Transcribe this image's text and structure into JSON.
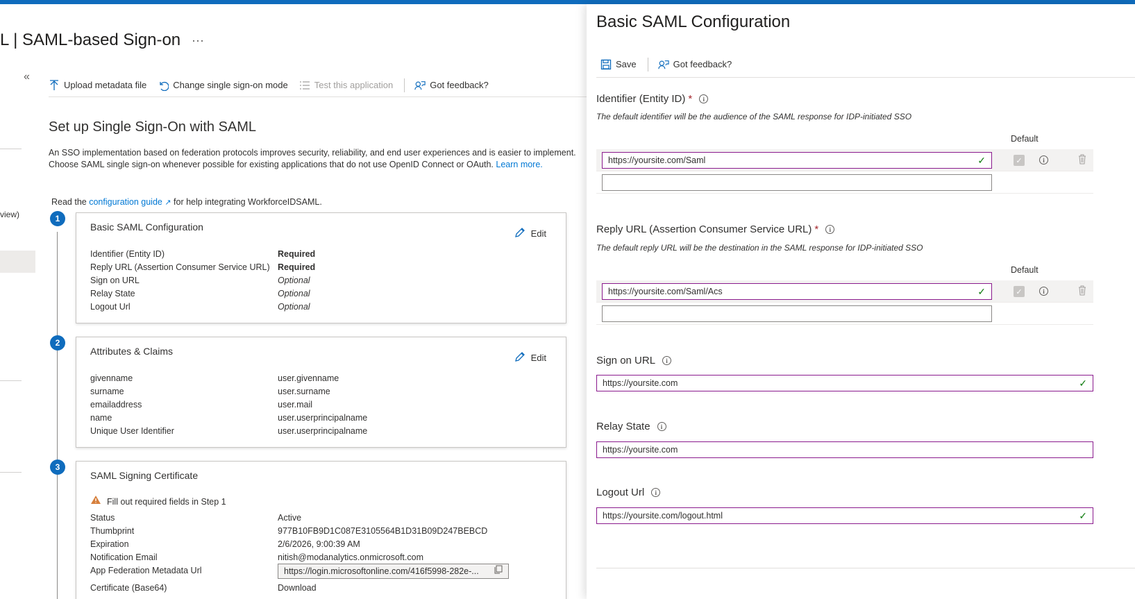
{
  "page": {
    "title": "L | SAML-based Sign-on",
    "more": "···",
    "collapse": "«",
    "nav_partial_text": "view)"
  },
  "toolbar": {
    "upload": "Upload metadata file",
    "change_mode": "Change single sign-on mode",
    "test": "Test this application",
    "feedback": "Got feedback?"
  },
  "setup": {
    "heading": "Set up Single Sign-On with SAML",
    "intro": "An SSO implementation based on federation protocols improves security, reliability, and end user experiences and is easier to implement. Choose SAML single sign-on whenever possible for existing applications that do not use OpenID Connect or OAuth.",
    "learn_more": "Learn more.",
    "read_prefix": "Read the",
    "config_guide": "configuration guide",
    "read_suffix": "for help integrating WorkforceIDSAML."
  },
  "steps": [
    {
      "number": "1",
      "title": "Basic SAML Configuration",
      "edit": "Edit",
      "rows": [
        {
          "key": "Identifier (Entity ID)",
          "value": "Required"
        },
        {
          "key": "Reply URL (Assertion Consumer Service URL)",
          "value": "Required"
        },
        {
          "key": "Sign on URL",
          "value": "Optional"
        },
        {
          "key": "Relay State",
          "value": "Optional"
        },
        {
          "key": "Logout Url",
          "value": "Optional"
        }
      ]
    },
    {
      "number": "2",
      "title": "Attributes & Claims",
      "edit": "Edit",
      "rows": [
        {
          "key": "givenname",
          "value": "user.givenname"
        },
        {
          "key": "surname",
          "value": "user.surname"
        },
        {
          "key": "emailaddress",
          "value": "user.mail"
        },
        {
          "key": "name",
          "value": "user.userprincipalname"
        },
        {
          "key": "Unique User Identifier",
          "value": "user.userprincipalname"
        }
      ]
    },
    {
      "number": "3",
      "title": "SAML Signing Certificate",
      "warning": "Fill out required fields in Step 1",
      "rows": [
        {
          "key": "Status",
          "value": "Active"
        },
        {
          "key": "Thumbprint",
          "value": "977B10FB9D1C087E3105564B1D31B09D247BEBCD"
        },
        {
          "key": "Expiration",
          "value": "2/6/2026, 9:00:39 AM"
        },
        {
          "key": "Notification Email",
          "value": "nitish@modanalytics.onmicrosoft.com"
        },
        {
          "key": "App Federation Metadata Url",
          "value": "https://login.microsoftonline.com/416f5998-282e-..."
        },
        {
          "key": "Certificate (Base64)",
          "value": "Download"
        }
      ]
    }
  ],
  "panel": {
    "title": "Basic SAML Configuration",
    "save": "Save",
    "feedback": "Got feedback?",
    "default_label": "Default",
    "identifier": {
      "label": "Identifier (Entity ID)",
      "required": "*",
      "description": "The default identifier will be the audience of the SAML response for IDP-initiated SSO",
      "value": "https://yoursite.com/Saml",
      "empty_value": ""
    },
    "reply": {
      "label": "Reply URL (Assertion Consumer Service URL)",
      "required": "*",
      "description": "The default reply URL will be the destination in the SAML response for IDP-initiated SSO",
      "value": "https://yoursite.com/Saml/Acs",
      "empty_value": ""
    },
    "sign_on": {
      "label": "Sign on URL",
      "value": "https://yoursite.com"
    },
    "relay": {
      "label": "Relay State",
      "value": "https://yoursite.com"
    },
    "logout": {
      "label": "Logout Url",
      "value": "https://yoursite.com/logout.html"
    }
  },
  "colors": {
    "accent": "#0f6cbd",
    "required": "#a4262c",
    "valid_border": "#8a1a8d",
    "check": "#107c10"
  }
}
